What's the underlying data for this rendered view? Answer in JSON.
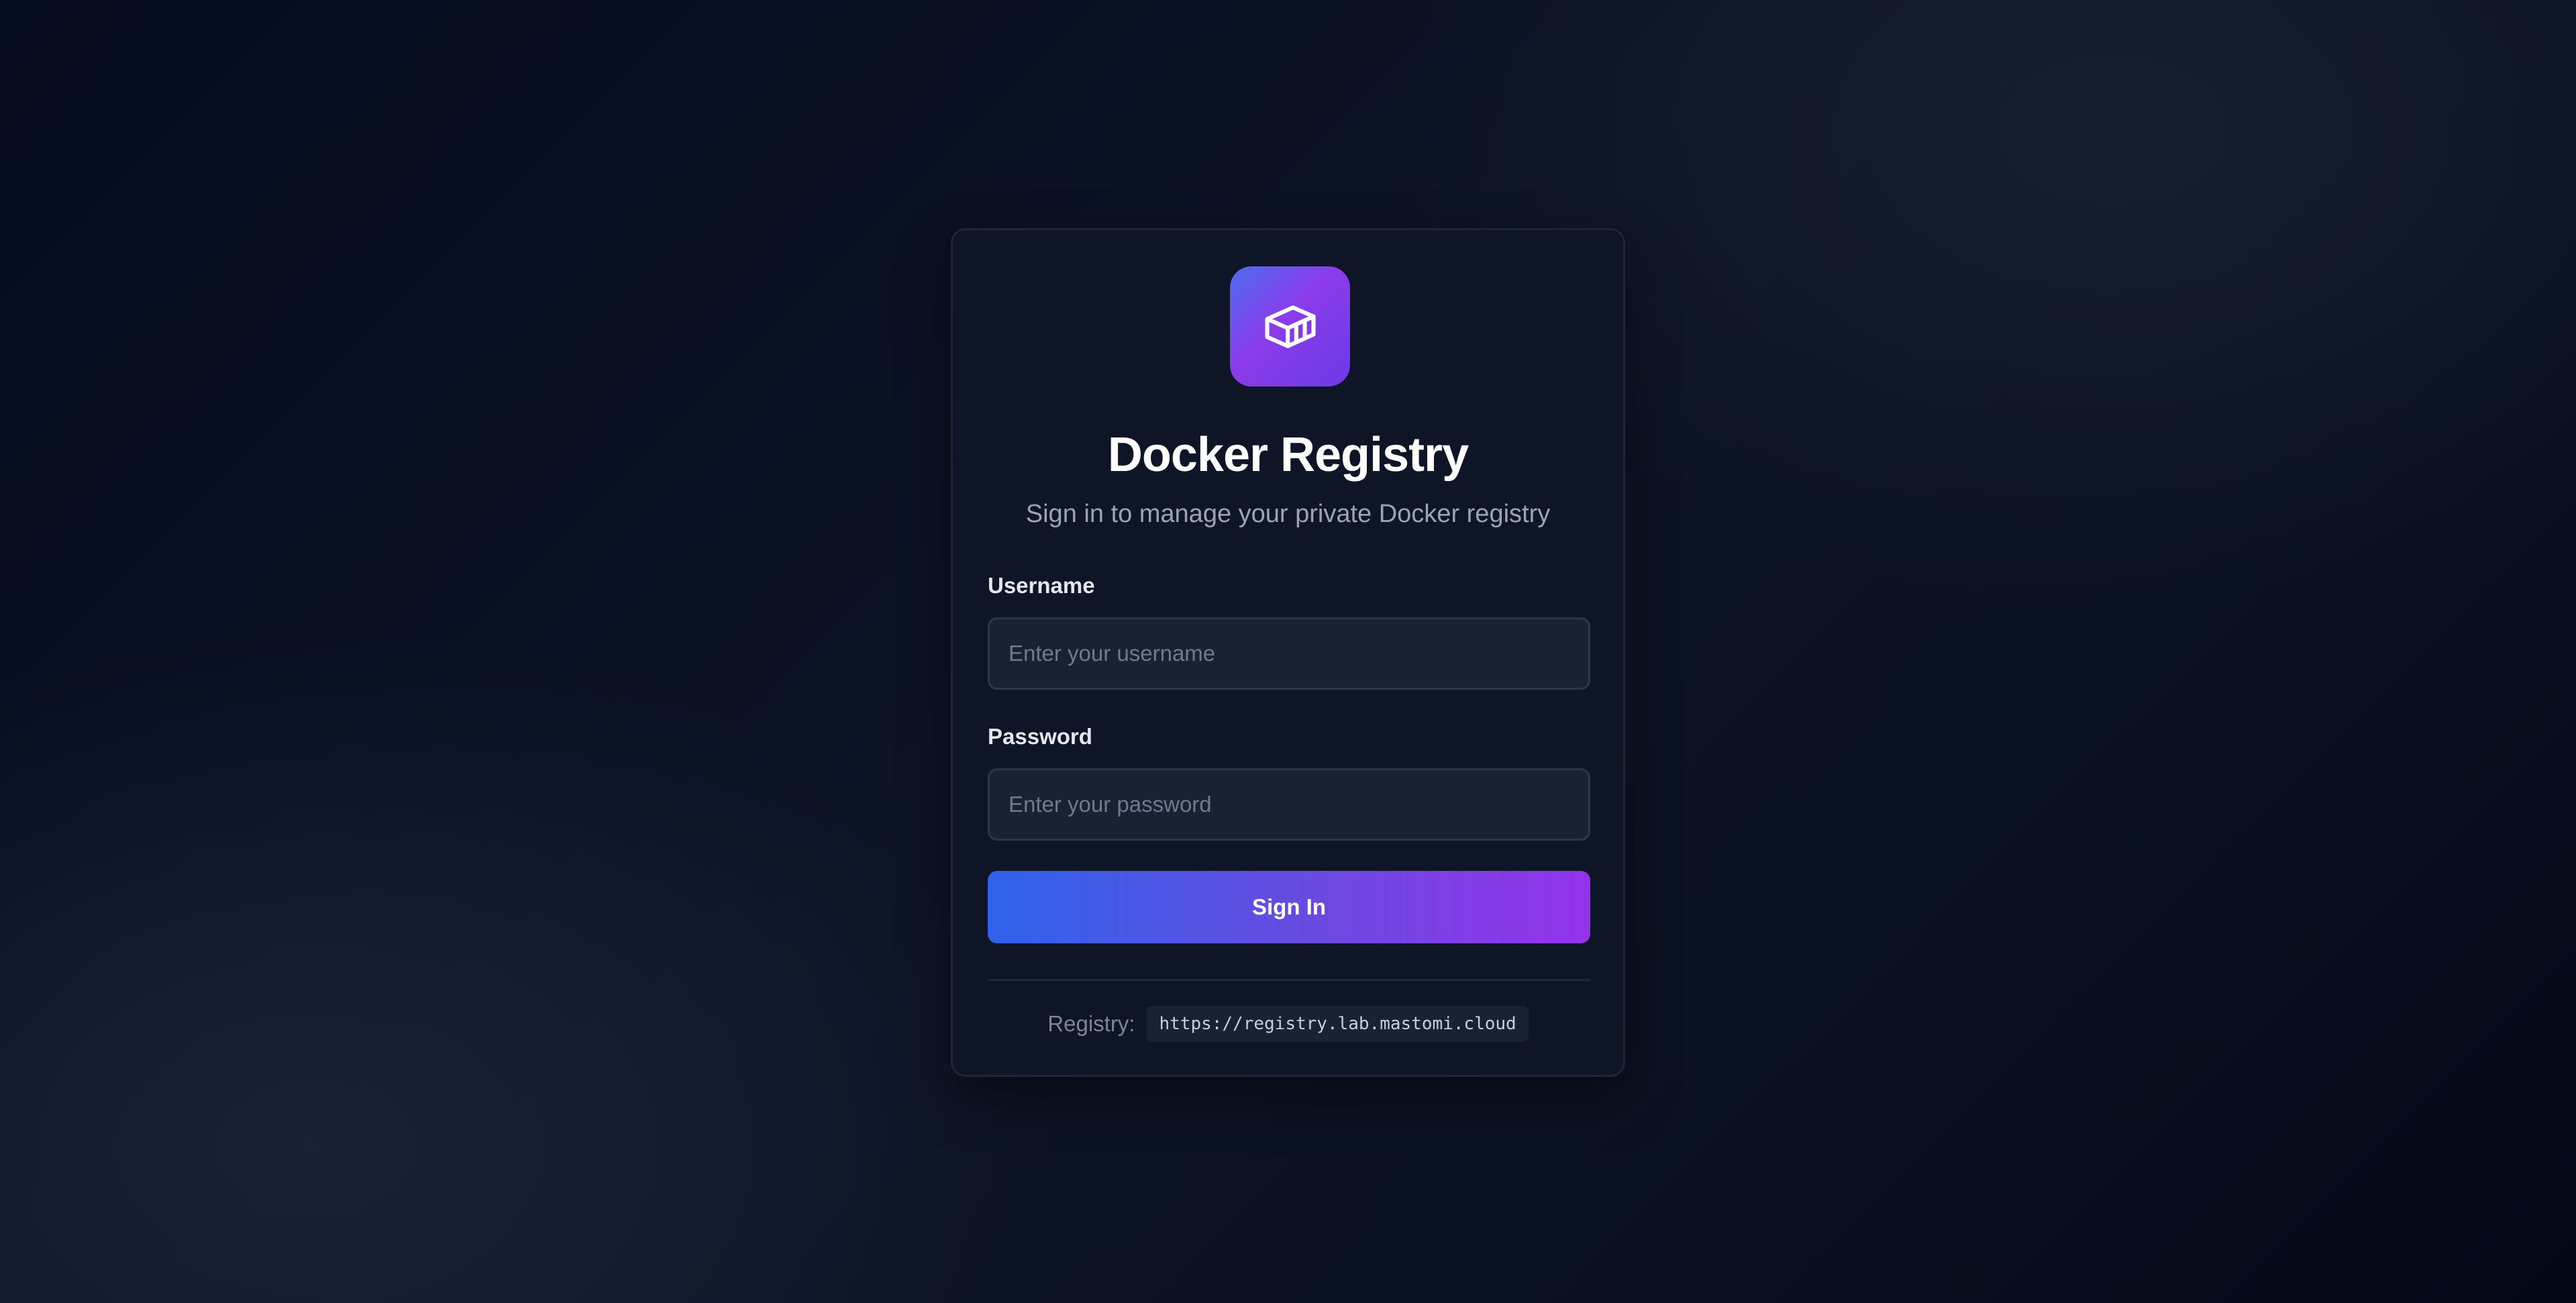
{
  "login": {
    "title": "Docker Registry",
    "subtitle": "Sign in to manage your private Docker registry",
    "logo_icon": "container-box-icon",
    "username": {
      "label": "Username",
      "placeholder": "Enter your username",
      "value": ""
    },
    "password": {
      "label": "Password",
      "placeholder": "Enter your password",
      "value": ""
    },
    "submit_label": "Sign In",
    "registry": {
      "label": "Registry:",
      "url": "https://registry.lab.mastomi.cloud"
    }
  },
  "colors": {
    "accent_start": "#2f63ea",
    "accent_end": "#9333ea",
    "card_background": "#0e1526",
    "page_background": "#0b1222"
  }
}
